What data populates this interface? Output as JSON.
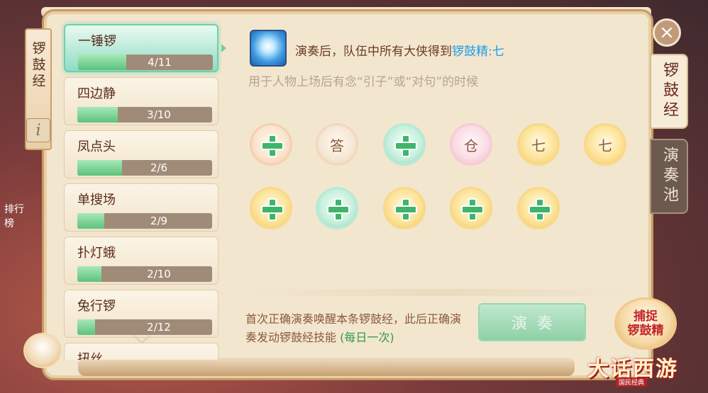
{
  "left_tag": {
    "title": "锣鼓经"
  },
  "left_side": {
    "ranking_label": "排行榜"
  },
  "songs": [
    {
      "name": "一锤锣",
      "progress": "4/11",
      "fill": 0.36,
      "active": true
    },
    {
      "name": "四边静",
      "progress": "3/10",
      "fill": 0.3,
      "active": false
    },
    {
      "name": "凤点头",
      "progress": "2/6",
      "fill": 0.33,
      "active": false
    },
    {
      "name": "单搜场",
      "progress": "2/9",
      "fill": 0.2,
      "active": false
    },
    {
      "name": "扑灯蛾",
      "progress": "2/10",
      "fill": 0.18,
      "active": false
    },
    {
      "name": "兔行锣",
      "progress": "2/12",
      "fill": 0.13,
      "active": false
    },
    {
      "name": "扭丝",
      "progress": "",
      "fill": 0,
      "active": false
    }
  ],
  "skill": {
    "icon": "gong-spirit-icon",
    "text_prefix": "演奏后，队伍中所有大侠得到",
    "text_highlight": "锣鼓精:七",
    "description": "用于人物上场后有念“引子”或“对句”的时候"
  },
  "tokens_row1": [
    {
      "style": "peach",
      "type": "plus",
      "label": ""
    },
    {
      "style": "cream",
      "type": "char",
      "label": "答"
    },
    {
      "style": "mint",
      "type": "plus",
      "label": ""
    },
    {
      "style": "pink",
      "type": "char",
      "label": "仓"
    },
    {
      "style": "gold",
      "type": "char",
      "label": "七"
    },
    {
      "style": "gold",
      "type": "char",
      "label": "七"
    }
  ],
  "tokens_row2": [
    {
      "style": "gold",
      "type": "plus",
      "label": ""
    },
    {
      "style": "mint",
      "type": "plus",
      "label": ""
    },
    {
      "style": "gold",
      "type": "plus",
      "label": ""
    },
    {
      "style": "gold",
      "type": "plus",
      "label": ""
    },
    {
      "style": "gold",
      "type": "plus",
      "label": ""
    }
  ],
  "note": {
    "main": "首次正确演奏唤醒本条锣鼓经，此后正确演奏发动锣鼓经技能",
    "daily": "(每日一次)"
  },
  "play_button": {
    "label": "演奏"
  },
  "close_button": {
    "label": "×"
  },
  "right_tabs": [
    {
      "label": "锣鼓经",
      "active": true
    },
    {
      "label": "演奏池",
      "active": false
    }
  ],
  "event_badge": {
    "line1": "捕捉",
    "line2": "锣鼓精"
  },
  "logo": {
    "title": "大话西游",
    "subtitle": "国民经典"
  },
  "colors": {
    "highlight_blue": "#1e9fe6",
    "daily_green": "#2f9a4a",
    "plus_green": "#3fb56b"
  }
}
